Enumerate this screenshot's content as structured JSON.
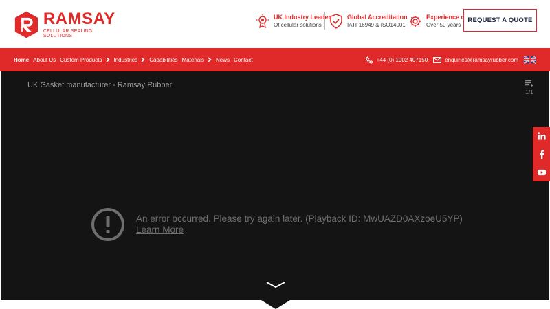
{
  "brand": {
    "name": "RAMSAY",
    "tagline": "CELLULAR SEALING SOLUTIONS"
  },
  "features": [
    {
      "icon": "award-icon",
      "title": "UK Industry Leader",
      "subtitle": "Of cellular solutions"
    },
    {
      "icon": "shield-check-icon",
      "title": "Global Accreditation",
      "subtitle": "IATF16949 & ISO14001"
    },
    {
      "icon": "gear-icon",
      "title": "Experience of",
      "subtitle": "Over 50 years"
    }
  ],
  "quote_button": "REQUEST A QUOTE",
  "nav": {
    "items": [
      {
        "label": "Home",
        "active": true,
        "submenu": false
      },
      {
        "label": "About Us",
        "active": false,
        "submenu": false
      },
      {
        "label": "Custom Products",
        "active": false,
        "submenu": true
      },
      {
        "label": "Industries",
        "active": false,
        "submenu": true
      },
      {
        "label": "Capabilities",
        "active": false,
        "submenu": false
      },
      {
        "label": "Materials",
        "active": false,
        "submenu": true
      },
      {
        "label": "News",
        "active": false,
        "submenu": false
      },
      {
        "label": "Contact",
        "active": false,
        "submenu": false
      }
    ],
    "phone": "+44 (0) 1902 407150",
    "email": "enquiries@ramsayrubber.com",
    "flag_icon": "uk-flag-icon"
  },
  "video": {
    "title": "UK Gasket manufacturer - Ramsay Rubber",
    "playlist_count": "1/1",
    "error_message": "An error occurred. Please try again later. (Playback ID: MwUAZD0AXzoeU5YP)",
    "error_link": "Learn More"
  },
  "social": [
    {
      "name": "linkedin-icon",
      "glyph": "in"
    },
    {
      "name": "facebook-icon",
      "glyph": "f"
    },
    {
      "name": "youtube-icon",
      "glyph": "▶"
    }
  ],
  "colors": {
    "brand_red": "#e02a2a",
    "navy": "#1f2a44",
    "video_bg": "#141414"
  }
}
